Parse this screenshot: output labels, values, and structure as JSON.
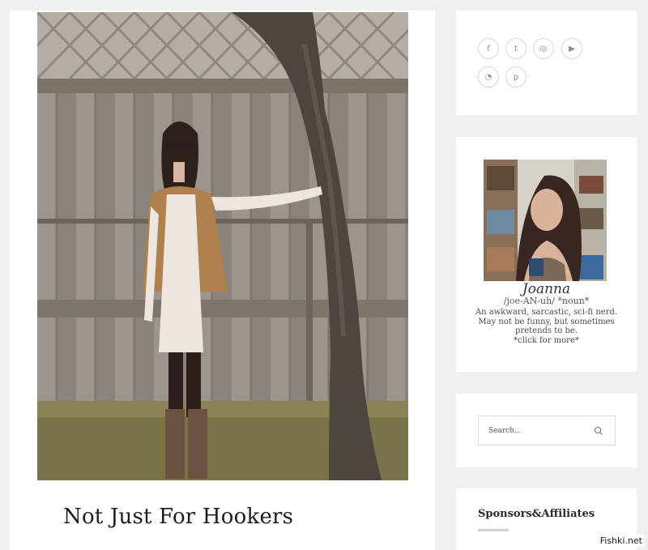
{
  "post": {
    "title": "Not Just For Hookers",
    "photo_icon": "outfit-photo"
  },
  "social": {
    "buttons": [
      {
        "icon": "facebook-icon",
        "glyph": "f"
      },
      {
        "icon": "twitter-icon",
        "glyph": "t"
      },
      {
        "icon": "instagram-icon",
        "glyph": "◎"
      },
      {
        "icon": "youtube-icon",
        "glyph": "▶"
      },
      {
        "icon": "rss-icon",
        "glyph": "◔"
      },
      {
        "icon": "pinterest-icon",
        "glyph": "p"
      }
    ]
  },
  "about": {
    "name": "Joanna",
    "phonetic": "/joe-AN-uh/ *noun*",
    "description": "An awkward, sarcastic, sci-fi nerd. May not be funny, but sometimes pretends to be.",
    "more_link": "*click for more*"
  },
  "search": {
    "placeholder": "Search...",
    "value": ""
  },
  "sponsors": {
    "title": "Sponsors&Affiliates"
  },
  "watermark": "Fishki.net",
  "colors": {
    "background": "#f0f0f0",
    "card": "#ffffff",
    "border": "#d6d6d6"
  }
}
